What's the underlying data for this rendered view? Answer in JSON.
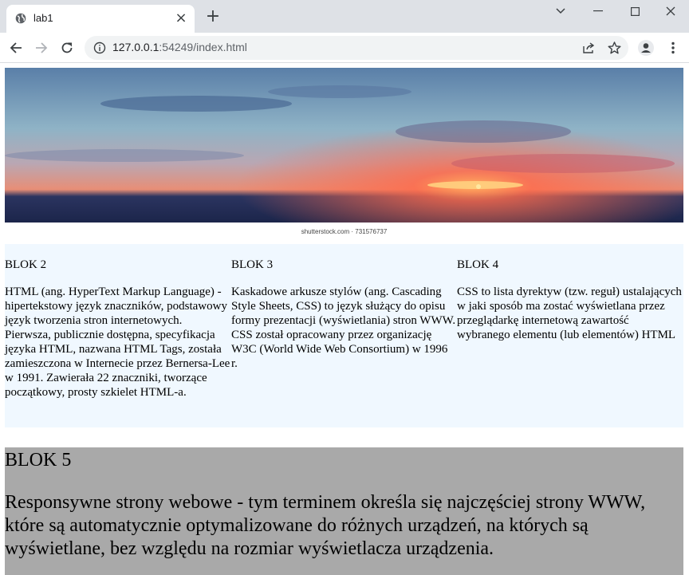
{
  "browser": {
    "tab_title": "lab1",
    "url_host": "127.0.0.1",
    "url_rest": ":54249/index.html"
  },
  "page": {
    "hero_caption": "shutterstock.com · 731576737",
    "blocks": [
      {
        "title": "BLOK 2",
        "text": "HTML (ang. HyperText Markup Language) - hipertekstowy język znaczników, podstawowy język tworzenia stron internetowych.",
        "text2": "Pierwsza, publicznie dostępna, specyfikacja języka HTML, nazwana HTML Tags, została zamieszczona w Internecie przez Bernersa-Lee w 1991. Zawierała 22 znaczniki, tworzące początkowy, prosty szkielet HTML-a."
      },
      {
        "title": "BLOK 3",
        "text": "Kaskadowe arkusze stylów (ang. Cascading Style Sheets, CSS) to język służący do opisu formy prezentacji (wyświetlania) stron WWW.",
        "text2": "CSS został opracowany przez organizację W3C (World Wide Web Consortium) w 1996 r."
      },
      {
        "title": "BLOK 4",
        "text": "CSS to lista dyrektyw (tzw. reguł) ustalających w jaki sposób ma zostać wyświetlana przez przeglądarkę internetową zawartość wybranego elementu (lub elementów) HTML",
        "text2": ""
      }
    ],
    "blok5": {
      "title": "BLOK 5",
      "text": "Responsywne strony webowe - tym terminem określa się najczęściej strony WWW, które są automatycznie optymalizowane do różnych urządzeń, na których są wyświetlane, bez względu na rozmiar wyświetlacza urządzenia."
    }
  }
}
